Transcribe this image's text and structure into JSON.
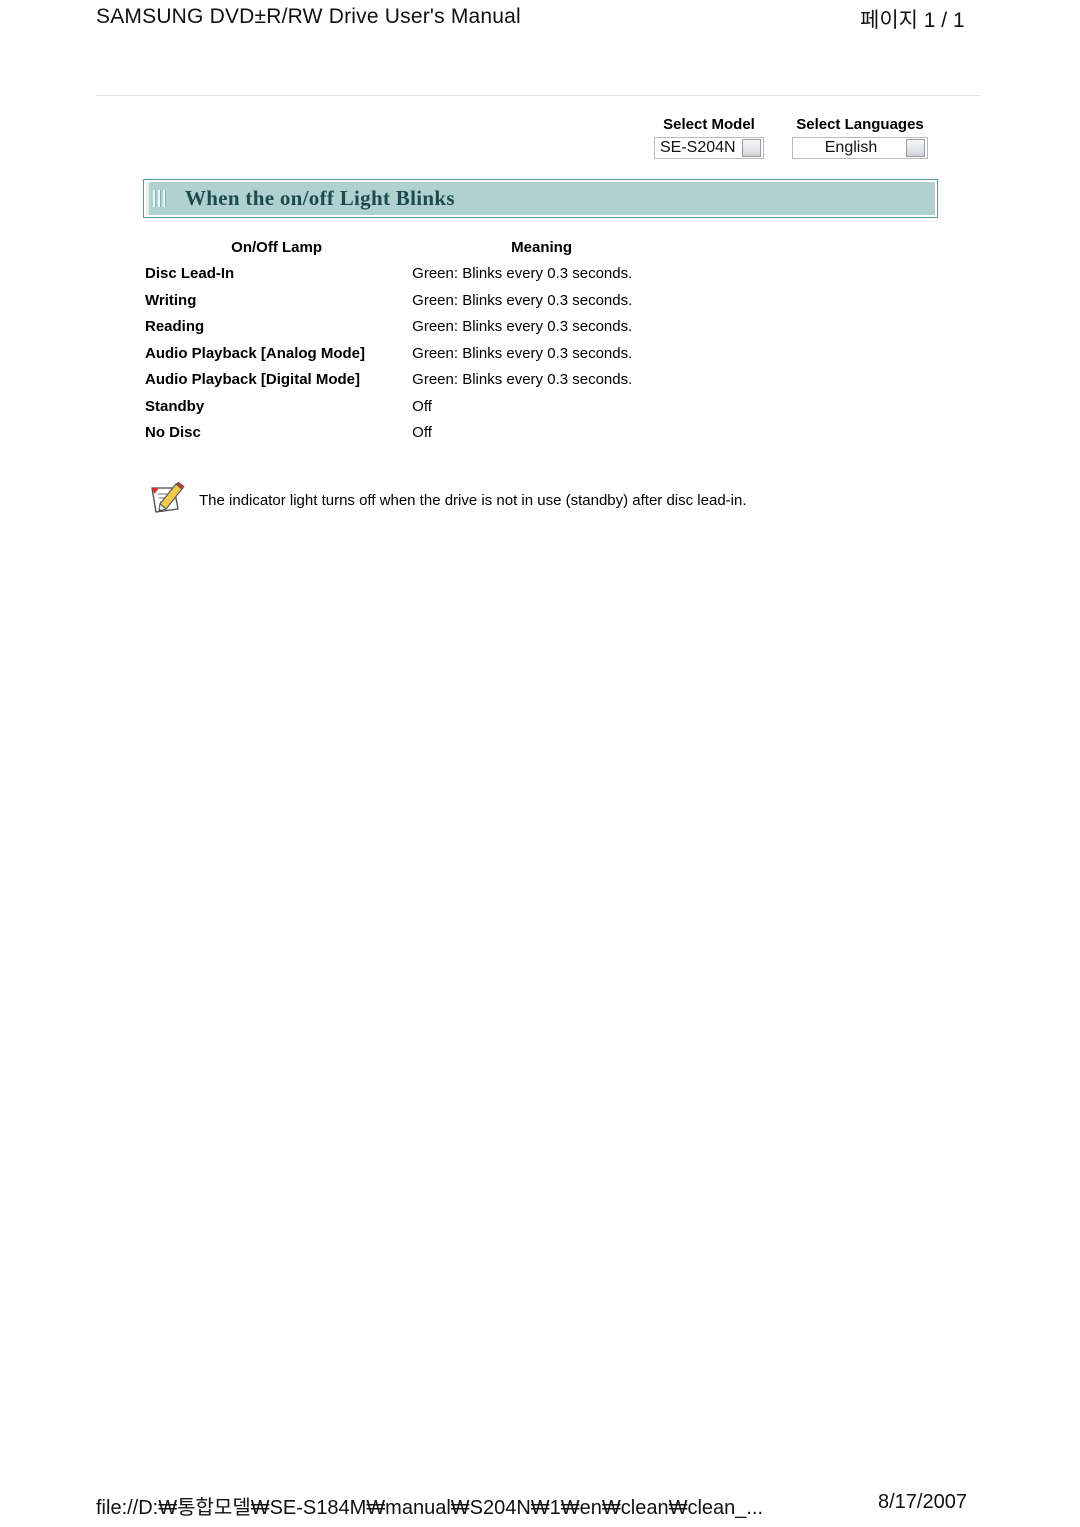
{
  "header": {
    "title": "SAMSUNG DVD±R/RW Drive User's Manual",
    "page_indicator": "페이지 1 / 1"
  },
  "selectors": {
    "model": {
      "label": "Select Model",
      "value": "SE-S204N",
      "arrow_icon": "dropdown-arrow-icon"
    },
    "language": {
      "label": "Select Languages",
      "value": "English",
      "arrow_icon": "dropdown-arrow-icon"
    }
  },
  "section": {
    "icon": "vertical-bars-icon",
    "title": "When the on/off Light Blinks",
    "banner_bg": "#afd2d0",
    "banner_border": "#5a9b9a",
    "title_color": "#1d4a4c"
  },
  "table": {
    "columns": [
      "On/Off Lamp",
      "Meaning"
    ],
    "rows": [
      {
        "lamp": "Disc Lead-In",
        "meaning": "Green: Blinks every 0.3 seconds."
      },
      {
        "lamp": "Writing",
        "meaning": "Green: Blinks every 0.3 seconds."
      },
      {
        "lamp": "Reading",
        "meaning": "Green: Blinks every 0.3 seconds."
      },
      {
        "lamp": "Audio Playback [Analog Mode]",
        "meaning": "Green: Blinks every 0.3 seconds."
      },
      {
        "lamp": "Audio Playback [Digital Mode]",
        "meaning": "Green: Blinks every 0.3 seconds."
      },
      {
        "lamp": "Standby",
        "meaning": "Off"
      },
      {
        "lamp": "No Disc",
        "meaning": "Off"
      }
    ]
  },
  "note": {
    "icon": "note-pencil-icon",
    "text": "The indicator light turns off when the drive is not in use (standby) after disc lead-in."
  },
  "footer": {
    "path": "file://D:₩통합모델₩SE-S184M₩manual₩S204N₩1₩en₩clean₩clean_...",
    "date": "8/17/2007"
  }
}
